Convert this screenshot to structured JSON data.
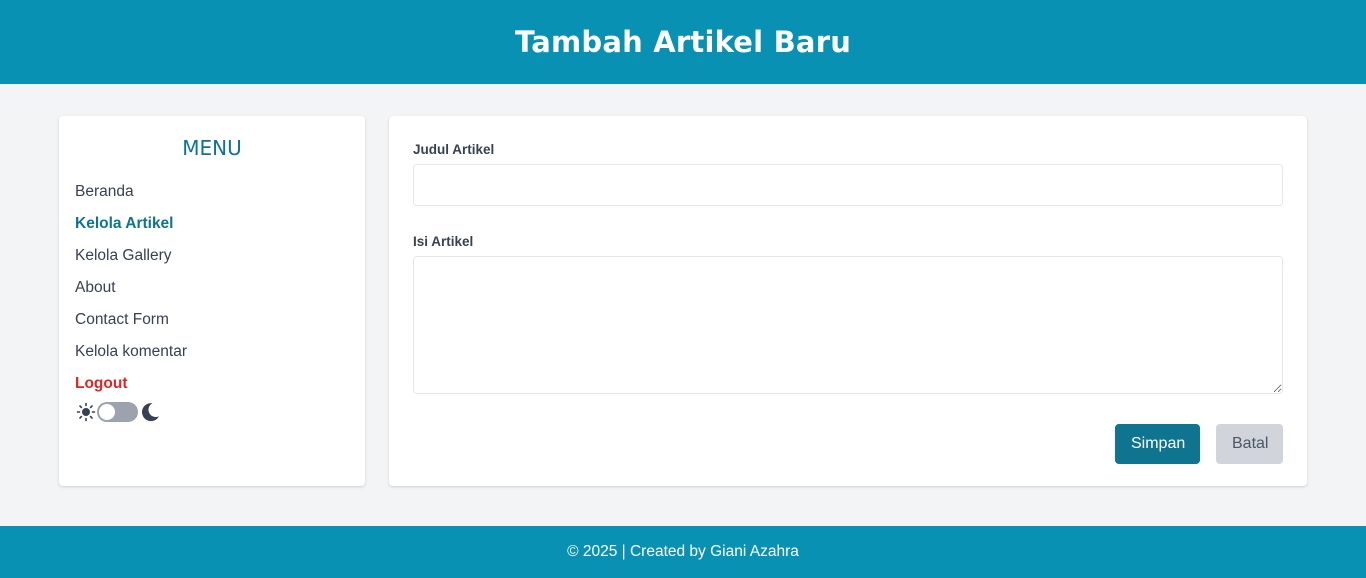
{
  "header": {
    "title": "Tambah Artikel Baru"
  },
  "sidebar": {
    "title": "MENU",
    "items": [
      {
        "label": "Beranda",
        "state": "normal"
      },
      {
        "label": "Kelola Artikel",
        "state": "active"
      },
      {
        "label": "Kelola Gallery",
        "state": "normal"
      },
      {
        "label": "About",
        "state": "normal"
      },
      {
        "label": "Contact Form",
        "state": "normal"
      },
      {
        "label": "Kelola komentar",
        "state": "normal"
      },
      {
        "label": "Logout",
        "state": "logout"
      }
    ],
    "theme_toggle": {
      "left_icon": "sun-icon",
      "right_icon": "moon-icon",
      "dark_mode": false
    }
  },
  "form": {
    "title_label": "Judul Artikel",
    "title_value": "",
    "content_label": "Isi Artikel",
    "content_value": "",
    "save_label": "Simpan",
    "cancel_label": "Batal"
  },
  "footer": {
    "text": "© 2025 | Created by Giani Azahra"
  },
  "colors": {
    "primary": "#0891b2",
    "primary_dark": "#0e7490",
    "danger": "#dc2626",
    "background": "#f3f4f6",
    "cancel_bg": "#d1d5db"
  }
}
